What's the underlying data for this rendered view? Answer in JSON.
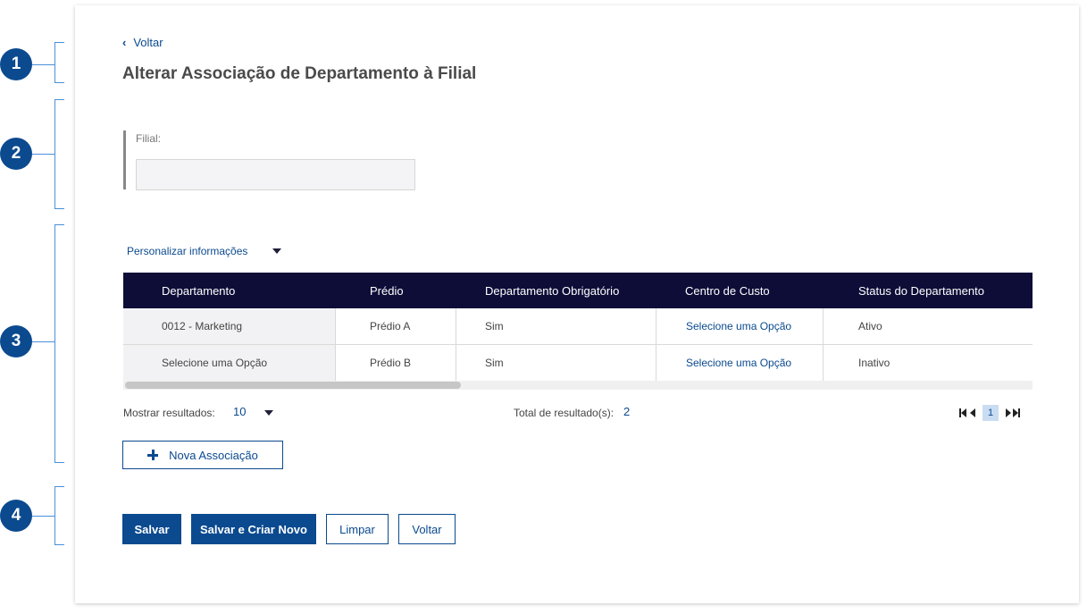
{
  "markers": [
    "1",
    "2",
    "3",
    "4"
  ],
  "colors": {
    "primary": "#0b4a8f",
    "table_header": "#0d0d38",
    "annotation": "#4a90d9"
  },
  "nav": {
    "back_label": "Voltar",
    "back_icon": "chevron-left-icon"
  },
  "page": {
    "title": "Alterar Associação de Departamento à Filial"
  },
  "form": {
    "filial_label": "Filial:",
    "filial_value": ""
  },
  "customize": {
    "label": "Personalizar informações"
  },
  "table": {
    "headers": [
      "Departamento",
      "Prédio",
      "Departamento Obrigatório",
      "Centro de Custo",
      "Status do Departamento"
    ],
    "rows": [
      [
        "0012 - Marketing",
        "Prédio A",
        "Sim",
        "Selecione uma Opção",
        "Ativo"
      ],
      [
        "Selecione uma Opção",
        "Prédio B",
        "Sim",
        "Selecione uma Opção",
        "Inativo"
      ]
    ]
  },
  "pagination": {
    "show_label": "Mostrar resultados:",
    "show_value": "10",
    "total_label": "Total de resultado(s):",
    "total_value": "2",
    "current_page": "1"
  },
  "actions": {
    "new_association": "Nova Associação",
    "save": "Salvar",
    "save_and_new": "Salvar e Criar Novo",
    "clear": "Limpar",
    "back": "Voltar"
  }
}
